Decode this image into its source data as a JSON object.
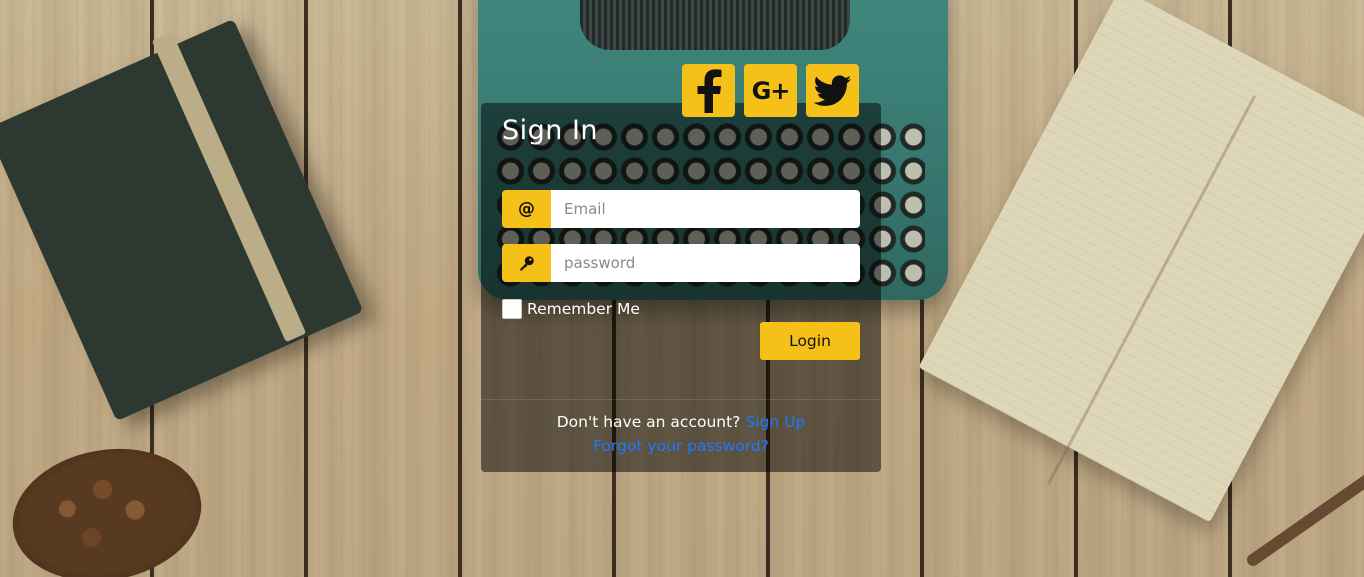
{
  "social": {
    "facebook": {
      "icon": "facebook-icon"
    },
    "google_plus": {
      "icon": "google-plus-icon",
      "label": "G+"
    },
    "twitter": {
      "icon": "twitter-icon"
    }
  },
  "card": {
    "title": "Sign In",
    "email": {
      "addon": "@",
      "placeholder": "Email",
      "value": ""
    },
    "password": {
      "addon_icon": "key-icon",
      "placeholder": "password",
      "value": ""
    },
    "remember_label": "Remember Me",
    "login_label": "Login",
    "footer": {
      "no_account_text": "Don't have an account?",
      "signup_link": "Sign Up",
      "forgot_link": "Forgot your password?"
    }
  },
  "colors": {
    "accent": "#f5c018",
    "link": "#1e78ff",
    "card_bg": "rgba(0,0,0,0.5)"
  }
}
